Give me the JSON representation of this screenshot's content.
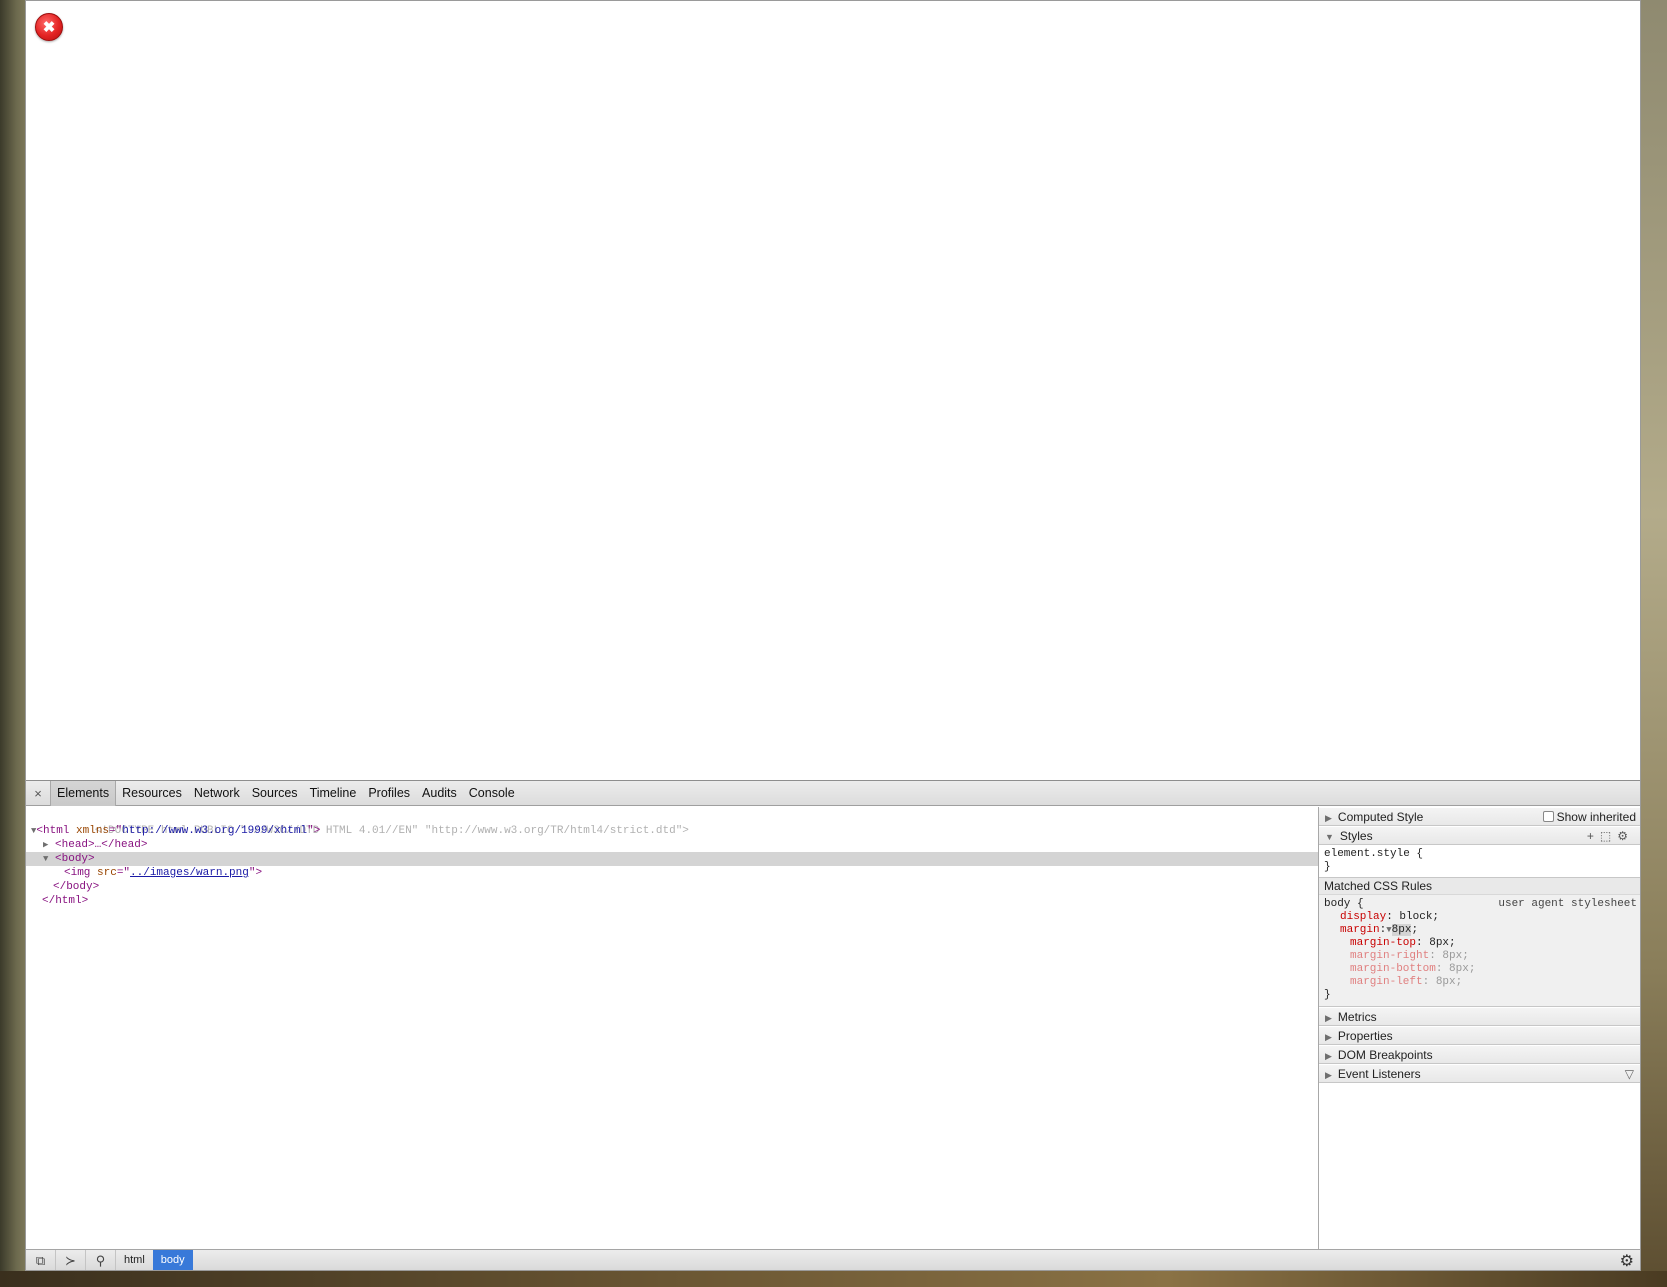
{
  "page": {
    "warn_icon_glyph": "✖"
  },
  "devtools": {
    "close_glyph": "×",
    "tabs": [
      "Elements",
      "Resources",
      "Network",
      "Sources",
      "Timeline",
      "Profiles",
      "Audits",
      "Console"
    ],
    "active_tab": "Elements",
    "dom": {
      "doctype": "<!DOCTYPE html PUBLIC \"-//W3C//DTD HTML 4.01//EN\" \"http://www.w3.org/TR/html4/strict.dtd\">",
      "html_open_tag": "<html",
      "html_attr_name": "xmlns",
      "html_attr_value": "http://www.w3.org/1999/xhtml",
      "head_collapsed": "<head>…</head>",
      "body_open": "<body>",
      "img_tag": "<img",
      "img_attr_name": "src",
      "img_attr_value": "../images/warn.png",
      "body_close": "</body>",
      "html_close": "</html>"
    },
    "sidebar": {
      "computed_style": "Computed Style",
      "show_inherited": "Show inherited",
      "styles": "Styles",
      "element_style_open": "element.style {",
      "close_brace": "}",
      "matched_css_rules": "Matched CSS Rules",
      "body_selector": "body {",
      "user_agent_stylesheet": "user agent stylesheet",
      "props": {
        "display_name": "display",
        "display_value": "block;",
        "margin_name": "margin",
        "margin_value": "8px",
        "margin_top_name": "margin-top",
        "margin_top_value": "8px;",
        "margin_right_name": "margin-right",
        "margin_right_value": "8px;",
        "margin_bottom_name": "margin-bottom",
        "margin_bottom_value": "8px;",
        "margin_left_name": "margin-left",
        "margin_left_value": "8px;"
      },
      "metrics": "Metrics",
      "properties": "Properties",
      "dom_breakpoints": "DOM Breakpoints",
      "event_listeners": "Event Listeners"
    },
    "breadcrumbs": [
      "html",
      "body"
    ],
    "active_crumb": "body"
  }
}
